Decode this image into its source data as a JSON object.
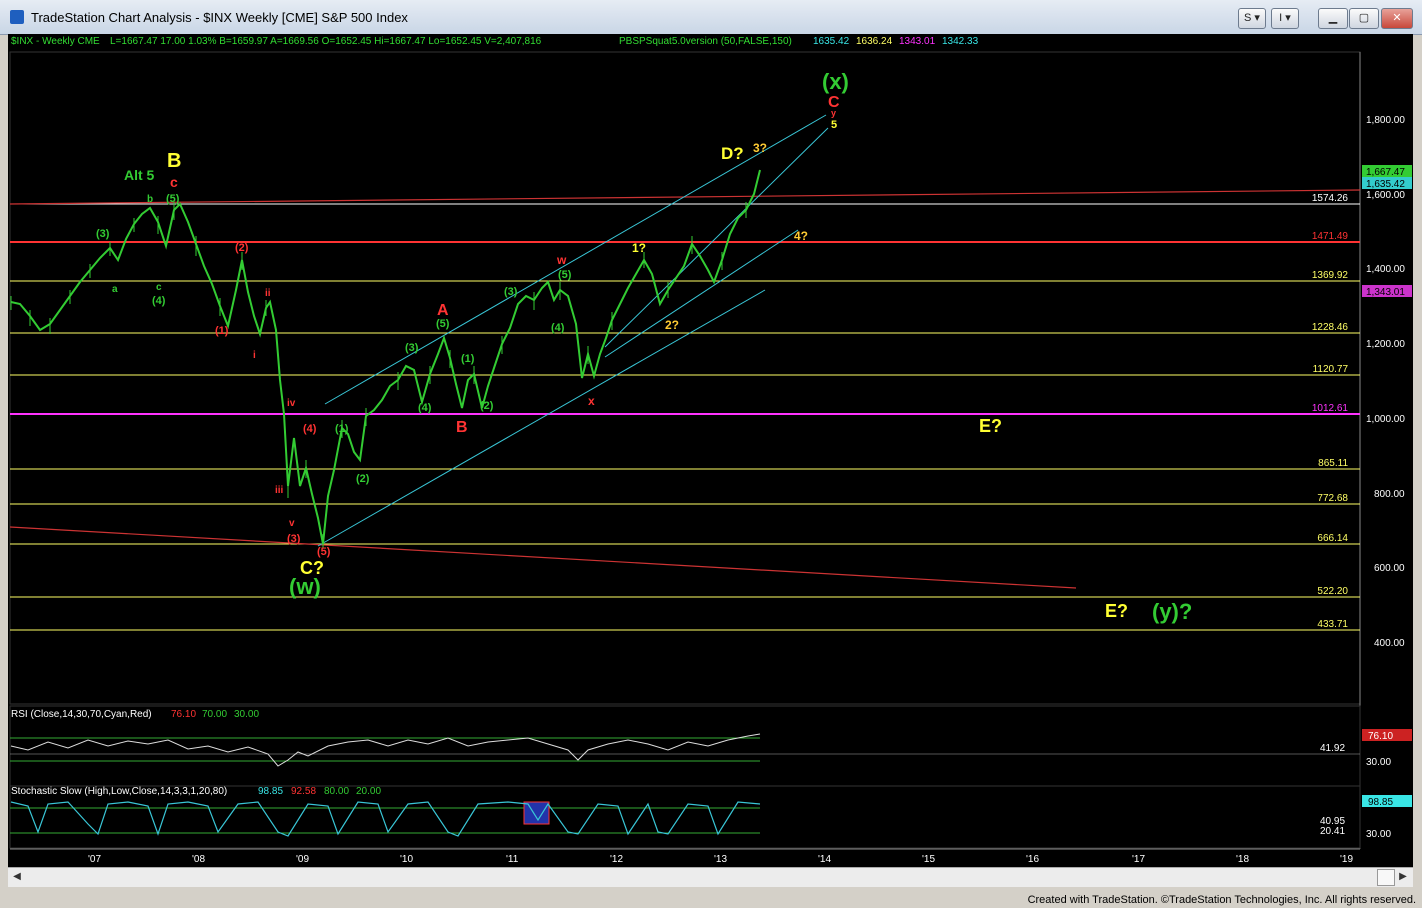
{
  "window": {
    "title": "TradeStation Chart Analysis - $INX Weekly [CME] S&P 500 Index",
    "buttons": [
      "S",
      "I"
    ]
  },
  "chart": {
    "header": {
      "symbol": "$INX - Weekly  CME",
      "ohlc": "L=1667.47  17.00  1.03%  B=1659.97  A=1669.56  O=1652.45  Hi=1667.47  Lo=1652.45  V=2,407,816",
      "indicator": "PBSPSquat5.0version (50,FALSE,150)",
      "ind_values": [
        {
          "text": "1635.42",
          "color": "#39e6e6"
        },
        {
          "text": "1636.24",
          "color": "#ffff66"
        },
        {
          "text": "1343.01",
          "color": "#ff33ff"
        },
        {
          "text": "1342.33",
          "color": "#39e6e6"
        }
      ]
    },
    "price_axis": [
      "1,800.00",
      "1,600.00",
      "1,400.00",
      "1,200.00",
      "1,000.00",
      "800.00",
      "600.00",
      "400.00"
    ],
    "price_tags": [
      {
        "text": "1,667.47",
        "bg": "#33cc33",
        "fg": "#000000"
      },
      {
        "text": "1,635.42",
        "bg": "#33cccc",
        "fg": "#000000"
      },
      {
        "text": "1,343.01",
        "bg": "#cc33cc",
        "fg": "#000000"
      }
    ],
    "levels": [
      {
        "text": "1574.26",
        "color": "#ffffff"
      },
      {
        "text": "1471.49",
        "color": "#ff3333"
      },
      {
        "text": "1369.92",
        "color": "#ffff66"
      },
      {
        "text": "1228.46",
        "color": "#ffff66"
      },
      {
        "text": "1120.77",
        "color": "#ffff66"
      },
      {
        "text": "1012.61",
        "color": "#ff33ff"
      },
      {
        "text": "865.11",
        "color": "#ffff66"
      },
      {
        "text": "772.68",
        "color": "#ffff66"
      },
      {
        "text": "666.14",
        "color": "#ffff66"
      },
      {
        "text": "522.20",
        "color": "#ffff66"
      },
      {
        "text": "433.71",
        "color": "#ffff66"
      }
    ],
    "wave_labels": [
      {
        "text": "(x)",
        "color": "#33cc33"
      },
      {
        "text": "C",
        "color": "#ff3333"
      },
      {
        "text": "y",
        "color": "#ff3333"
      },
      {
        "text": "5",
        "color": "#ffff33"
      },
      {
        "text": "D?",
        "color": "#ffff33"
      },
      {
        "text": "3?",
        "color": "#ffcc33"
      },
      {
        "text": "4?",
        "color": "#ffcc33"
      },
      {
        "text": "1?",
        "color": "#ffff33"
      },
      {
        "text": "2?",
        "color": "#ffcc33"
      },
      {
        "text": "w",
        "color": "#ff3333"
      },
      {
        "text": "(5)",
        "color": "#33cc33"
      },
      {
        "text": "(3)",
        "color": "#33cc33"
      },
      {
        "text": "(4)",
        "color": "#33cc33"
      },
      {
        "text": "x",
        "color": "#ff3333"
      },
      {
        "text": "A",
        "color": "#ff3333"
      },
      {
        "text": "(5)",
        "color": "#33cc33"
      },
      {
        "text": "(3)",
        "color": "#33cc33"
      },
      {
        "text": "(1)",
        "color": "#33cc33"
      },
      {
        "text": "(4)",
        "color": "#33cc33"
      },
      {
        "text": "(2)",
        "color": "#33cc33"
      },
      {
        "text": "B",
        "color": "#ff3333"
      },
      {
        "text": "(1)",
        "color": "#33cc33"
      },
      {
        "text": "(2)",
        "color": "#33cc33"
      },
      {
        "text": "B",
        "color": "#ffff33"
      },
      {
        "text": "c",
        "color": "#ff3333"
      },
      {
        "text": "(5)",
        "color": "#33cc33"
      },
      {
        "text": "Alt 5",
        "color": "#33cc33"
      },
      {
        "text": "b",
        "color": "#33cc33"
      },
      {
        "text": "(3)",
        "color": "#33cc33"
      },
      {
        "text": "a",
        "color": "#33cc33"
      },
      {
        "text": "c",
        "color": "#33cc33"
      },
      {
        "text": "(4)",
        "color": "#33cc33"
      },
      {
        "text": "(2)",
        "color": "#ff3333"
      },
      {
        "text": "ii",
        "color": "#ff3333"
      },
      {
        "text": "(1)",
        "color": "#ff3333"
      },
      {
        "text": "i",
        "color": "#ff3333"
      },
      {
        "text": "iv",
        "color": "#ff3333"
      },
      {
        "text": "(4)",
        "color": "#ff3333"
      },
      {
        "text": "iii",
        "color": "#ff3333"
      },
      {
        "text": "v",
        "color": "#ff3333"
      },
      {
        "text": "(3)",
        "color": "#ff3333"
      },
      {
        "text": "(5)",
        "color": "#ff3333"
      },
      {
        "text": "C?",
        "color": "#ffff33"
      },
      {
        "text": "(w)",
        "color": "#33cc33"
      },
      {
        "text": "E?",
        "color": "#ffff33"
      },
      {
        "text": "E?",
        "color": "#ffff33"
      },
      {
        "text": "(y)?",
        "color": "#33cc33"
      }
    ],
    "rsi": {
      "label": "RSI (Close,14,30,70,Cyan,Red)",
      "values": [
        {
          "text": "76.10",
          "color": "#ff3333"
        },
        {
          "text": "70.00",
          "color": "#33cc33"
        },
        {
          "text": "30.00",
          "color": "#33cc33"
        }
      ],
      "axis": [
        "41.92",
        "30.00"
      ],
      "tag": "76.10"
    },
    "stoch": {
      "label": "Stochastic Slow (High,Low,Close,14,3,3,1,20,80)",
      "values": [
        {
          "text": "98.85",
          "color": "#39e6e6"
        },
        {
          "text": "92.58",
          "color": "#ff3333"
        },
        {
          "text": "80.00",
          "color": "#33cc33"
        },
        {
          "text": "20.00",
          "color": "#33cc33"
        }
      ],
      "axis": [
        "40.95",
        "20.41",
        "30.00"
      ],
      "tag": "98.85"
    },
    "x_axis": [
      "'07",
      "'08",
      "'09",
      "'10",
      "'11",
      "'12",
      "'13",
      "'14",
      "'15",
      "'16",
      "'17",
      "'18",
      "'19"
    ]
  },
  "footer": "Created with TradeStation. ©TradeStation Technologies, Inc. All rights reserved."
}
